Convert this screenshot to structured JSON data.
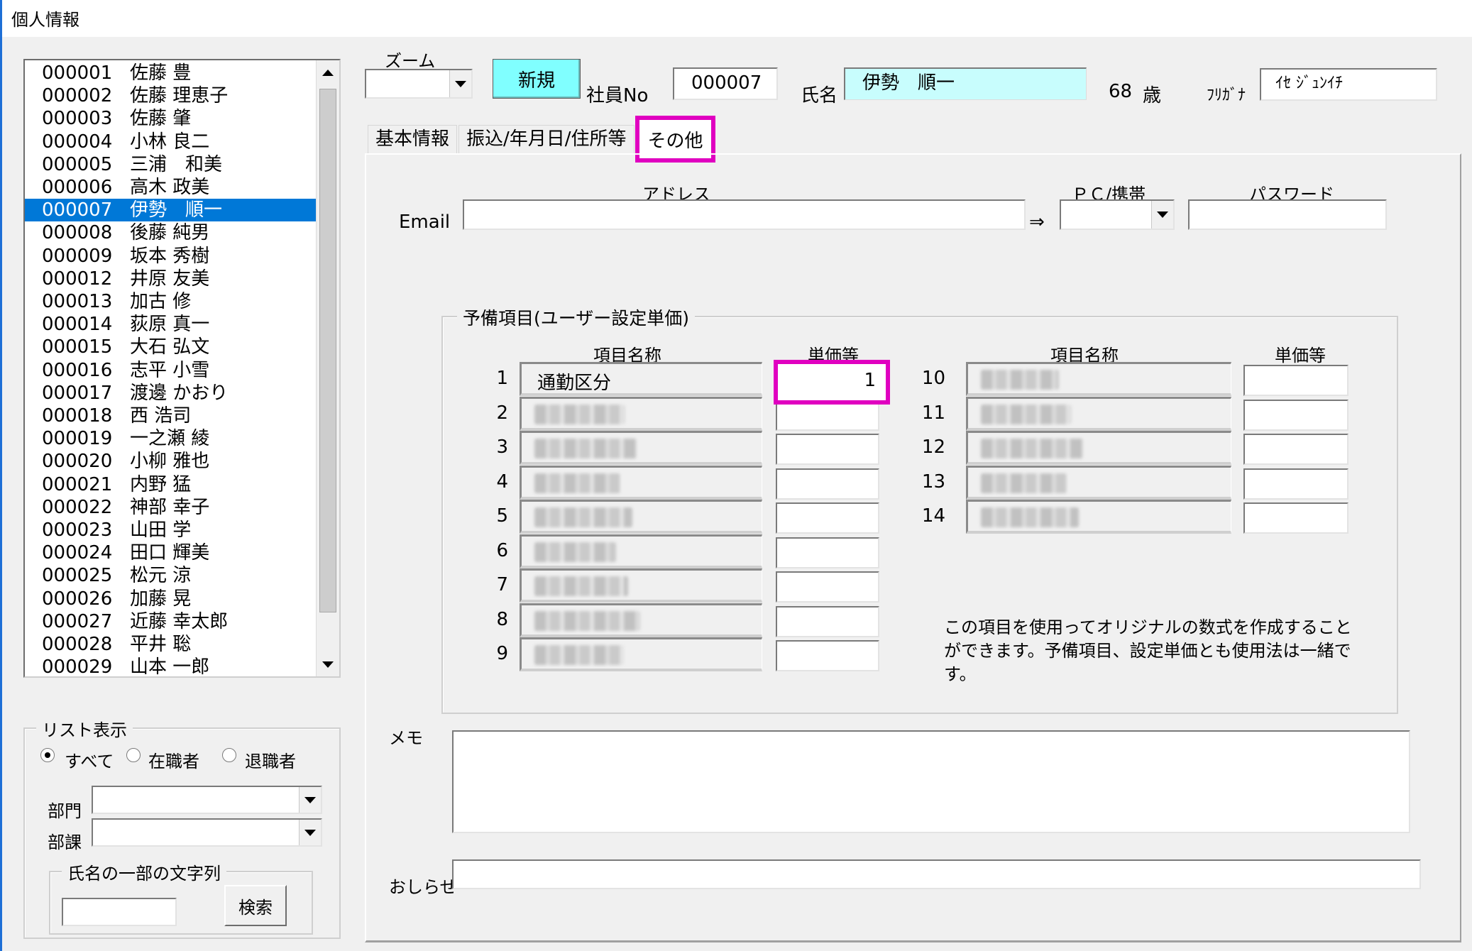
{
  "window": {
    "title": "個人情報"
  },
  "employees": [
    {
      "id": "000001",
      "name": "佐藤 豊"
    },
    {
      "id": "000002",
      "name": "佐藤 理恵子"
    },
    {
      "id": "000003",
      "name": "佐藤 肇"
    },
    {
      "id": "000004",
      "name": "小林 良二"
    },
    {
      "id": "000005",
      "name": "三浦　和美"
    },
    {
      "id": "000006",
      "name": "高木 政美"
    },
    {
      "id": "000007",
      "name": "伊勢　順一"
    },
    {
      "id": "000008",
      "name": "後藤 純男"
    },
    {
      "id": "000009",
      "name": "坂本 秀樹"
    },
    {
      "id": "000012",
      "name": "井原 友美"
    },
    {
      "id": "000013",
      "name": "加古 修"
    },
    {
      "id": "000014",
      "name": "荻原 真一"
    },
    {
      "id": "000015",
      "name": "大石 弘文"
    },
    {
      "id": "000016",
      "name": "志平 小雪"
    },
    {
      "id": "000017",
      "name": "渡邊 かおり"
    },
    {
      "id": "000018",
      "name": "西 浩司"
    },
    {
      "id": "000019",
      "name": "一之瀬 綾"
    },
    {
      "id": "000020",
      "name": "小柳 雅也"
    },
    {
      "id": "000021",
      "name": "内野 猛"
    },
    {
      "id": "000022",
      "name": "神部 幸子"
    },
    {
      "id": "000023",
      "name": "山田 学"
    },
    {
      "id": "000024",
      "name": "田口 輝美"
    },
    {
      "id": "000025",
      "name": "松元 涼"
    },
    {
      "id": "000026",
      "name": "加藤 晃"
    },
    {
      "id": "000027",
      "name": "近藤 幸太郎"
    },
    {
      "id": "000028",
      "name": "平井 聡"
    },
    {
      "id": "000029",
      "name": "山本 一郎"
    }
  ],
  "selected_employee": "000007",
  "list_display": {
    "title": "リスト表示",
    "options": [
      "すべて",
      "在職者",
      "退職者"
    ],
    "selected": "すべて",
    "dept_label": "部門",
    "section_label": "部課",
    "name_search_title": "氏名の一部の文字列",
    "search_button": "検索"
  },
  "header": {
    "zoom_label": "ズーム",
    "new_button": "新規",
    "emp_no_label": "社員No",
    "emp_no": "000007",
    "name_label": "氏名",
    "name": "伊勢　順一",
    "age": "68",
    "age_unit": "歳",
    "furigana_label": "ﾌﾘｶﾞﾅ",
    "furigana": "ｲｾ ｼﾞｭﾝｲﾁ"
  },
  "tabs": [
    "基本情報",
    "振込/年月日/住所等",
    "その他"
  ],
  "active_tab": "その他",
  "email": {
    "label": "Email",
    "address_header": "アドレス",
    "address": "",
    "arrow": "⇒",
    "pc_mobile_header": "ＰＣ/携帯",
    "password_header": "パスワード"
  },
  "reserve": {
    "title": "予備項目(ユーザー設定単価)",
    "item_name_header": "項目名称",
    "unit_price_header": "単価等",
    "items_left": [
      {
        "no": "1",
        "name": "通勤区分",
        "price": "1"
      },
      {
        "no": "2",
        "name": "",
        "price": ""
      },
      {
        "no": "3",
        "name": "",
        "price": ""
      },
      {
        "no": "4",
        "name": "",
        "price": ""
      },
      {
        "no": "5",
        "name": "",
        "price": ""
      },
      {
        "no": "6",
        "name": "",
        "price": ""
      },
      {
        "no": "7",
        "name": "",
        "price": ""
      },
      {
        "no": "8",
        "name": "",
        "price": ""
      },
      {
        "no": "9",
        "name": "",
        "price": ""
      }
    ],
    "items_right": [
      {
        "no": "10",
        "name": "",
        "price": ""
      },
      {
        "no": "11",
        "name": "",
        "price": ""
      },
      {
        "no": "12",
        "name": "",
        "price": ""
      },
      {
        "no": "13",
        "name": "",
        "price": ""
      },
      {
        "no": "14",
        "name": "",
        "price": ""
      }
    ],
    "note": "この項目を使用ってオリジナルの数式を作成することができます。予備項目、設定単価とも使用法は一緒です。"
  },
  "memo_label": "メモ",
  "notice_label": "おしらせ",
  "colors": {
    "selection": "#0078d7",
    "new_button": "#80ffff",
    "name_field": "#c8fdfd",
    "highlight": "#e000c0"
  }
}
